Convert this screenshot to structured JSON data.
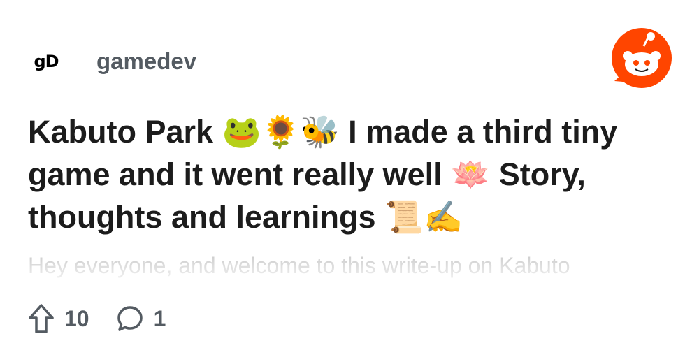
{
  "subreddit": {
    "avatar_text": "gD",
    "name": "gamedev"
  },
  "brand": {
    "logo_icon": "reddit-logo-icon",
    "accent": "#ff4500"
  },
  "post": {
    "title_parts": [
      "Kabuto Park ",
      "🐸🌻🐝",
      " I made a third tiny game and it went really well ",
      "🪷",
      " Story, thoughts and learnings ",
      "📜✍️"
    ],
    "preview": "Hey everyone, and welcome to this write-up on Kabuto",
    "upvotes": "10",
    "comments": "1"
  },
  "icons": {
    "upvote": "upvote-arrow-icon",
    "comment": "comment-bubble-icon"
  },
  "colors": {
    "title": "#1c1c1c",
    "meta": "#545b62",
    "preview": "#c8c8c8"
  }
}
